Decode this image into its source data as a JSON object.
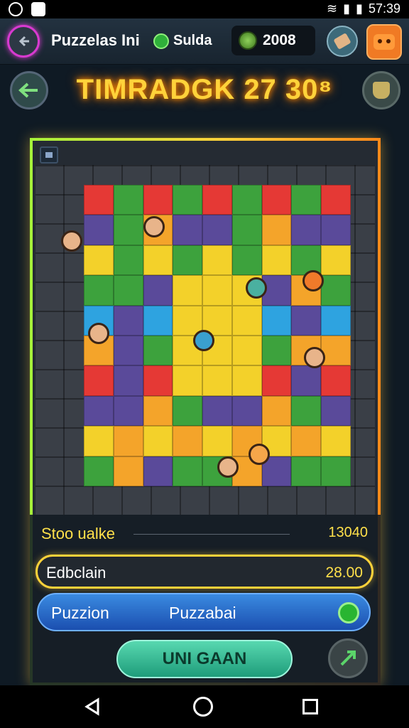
{
  "status_bar": {
    "time": "57:39"
  },
  "header": {
    "title": "Puzzelas Ini",
    "guide_label": "Sulda",
    "coins": "2008"
  },
  "headline": "TIMRADGK 27 30⁸",
  "board": {
    "colors": [
      "#e53935",
      "#f4a42a",
      "#2ea3e0",
      "#3da23d",
      "#f3d12a",
      "#5a4a9a"
    ]
  },
  "stats": {
    "label": "Stoo ualke",
    "value": "13040"
  },
  "edit_row": {
    "label": "Edbclain",
    "value": "28.00"
  },
  "puzzle_bar": {
    "left_label": "Puzzion",
    "right_label": "Puzzabai"
  },
  "start_button": "UNI GAAN"
}
